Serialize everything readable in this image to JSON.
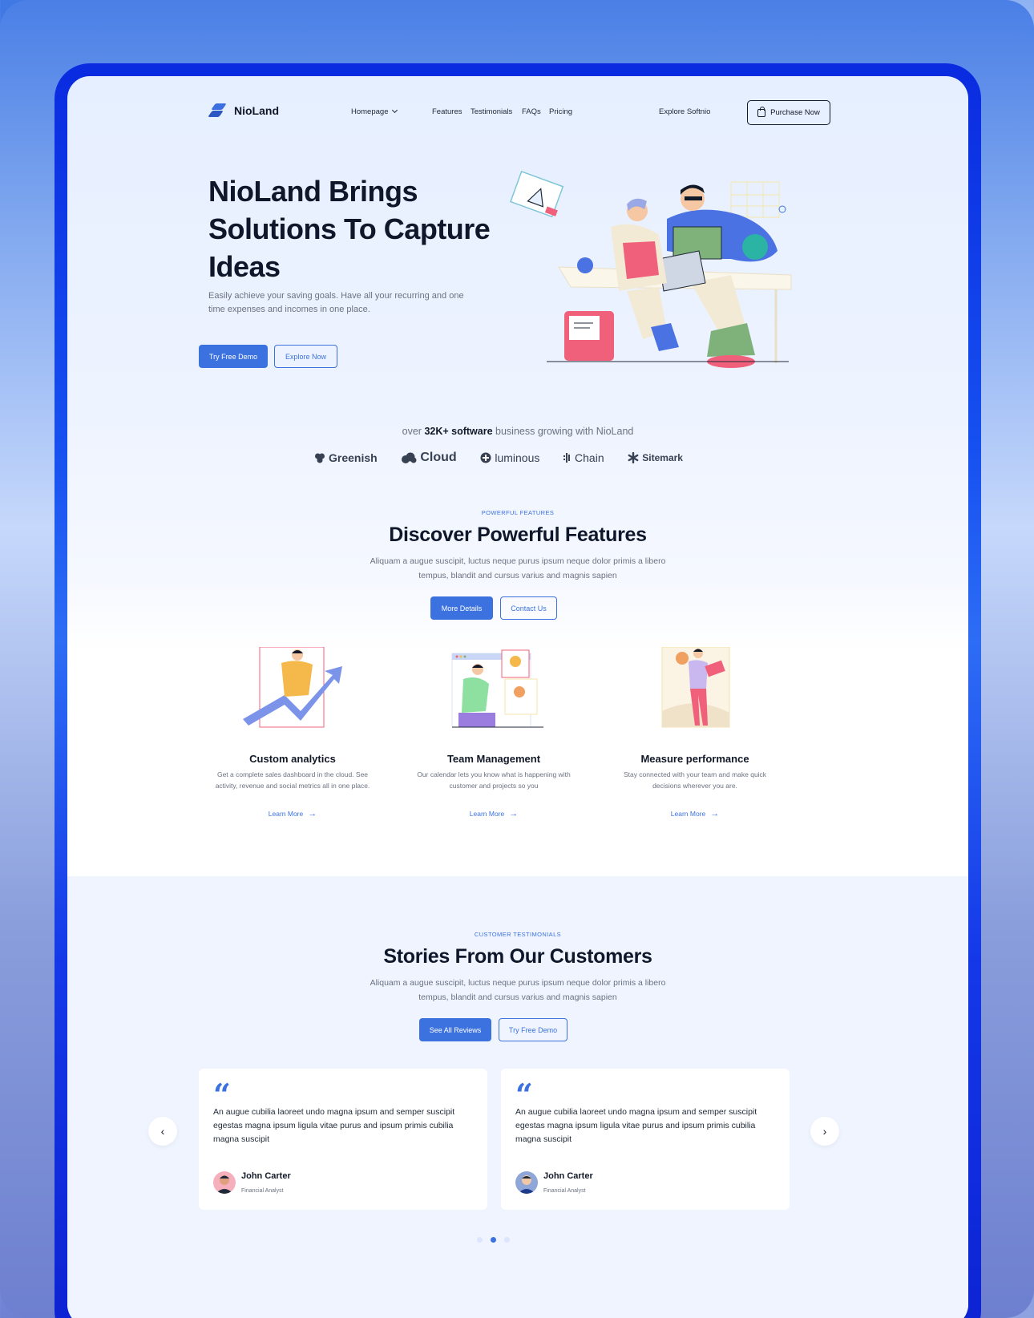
{
  "nav": {
    "logo": "NioLand",
    "links": [
      "Homepage",
      "Features",
      "Testimonials",
      "FAQs",
      "Pricing"
    ],
    "explore": "Explore Softnio",
    "purchase": "Purchase Now"
  },
  "hero": {
    "title": "NioLand Brings Solutions To Capture Ideas",
    "subtitle": "Easily achieve your saving goals. Have all your recurring and one time expenses and incomes in one place.",
    "primary_cta": "Try Free Demo",
    "secondary_cta": "Explore Now"
  },
  "brands": {
    "prefix": "over",
    "highlight": "32K+ software",
    "suffix": "business growing with NioLand",
    "items": [
      "Greenish",
      "Cloud",
      "luminous",
      "Chain",
      "Sitemark"
    ]
  },
  "features": {
    "eyebrow": "POWERFUL FEATURES",
    "title": "Discover Powerful Features",
    "subtitle": "Aliquam a augue suscipit, luctus neque purus ipsum neque dolor primis a libero tempus, blandit and cursus varius and magnis sapien",
    "primary_cta": "More Details",
    "secondary_cta": "Contact Us",
    "items": [
      {
        "title": "Custom analytics",
        "text": "Get a complete sales dashboard in the cloud. See activity, revenue and social metrics all in one place.",
        "link": "Learn More"
      },
      {
        "title": "Team Management",
        "text": "Our calendar lets you know what is happening with customer and projects so you",
        "link": "Learn More"
      },
      {
        "title": "Measure performance",
        "text": "Stay connected with your team and make quick decisions wherever  you are.",
        "link": "Learn More"
      }
    ]
  },
  "testimonials": {
    "eyebrow": "CUSTOMER TESTIMONIALS",
    "title": "Stories From Our Customers",
    "subtitle": "Aliquam a augue suscipit, luctus neque purus ipsum neque dolor primis a libero tempus, blandit and cursus varius and magnis sapien",
    "primary_cta": "See All Reviews",
    "secondary_cta": "Try Free Demo",
    "cards": [
      {
        "quote": "An augue cubilia laoreet undo magna ipsum and semper suscipit egestas magna ipsum ligula vitae purus and ipsum primis cubilia magna suscipit",
        "name": "John Carter",
        "role": "Financial Analyst"
      },
      {
        "quote": "An augue cubilia laoreet undo magna ipsum and semper suscipit egestas magna ipsum ligula vitae purus and ipsum primis cubilia magna suscipit",
        "name": "John Carter",
        "role": "Financial Analyst"
      }
    ],
    "prev_icon": "chevron-left-icon",
    "next_icon": "chevron-right-icon"
  },
  "colors": {
    "accent": "#3b72e0",
    "frame": "#1438e8",
    "text": "#0f172a"
  }
}
